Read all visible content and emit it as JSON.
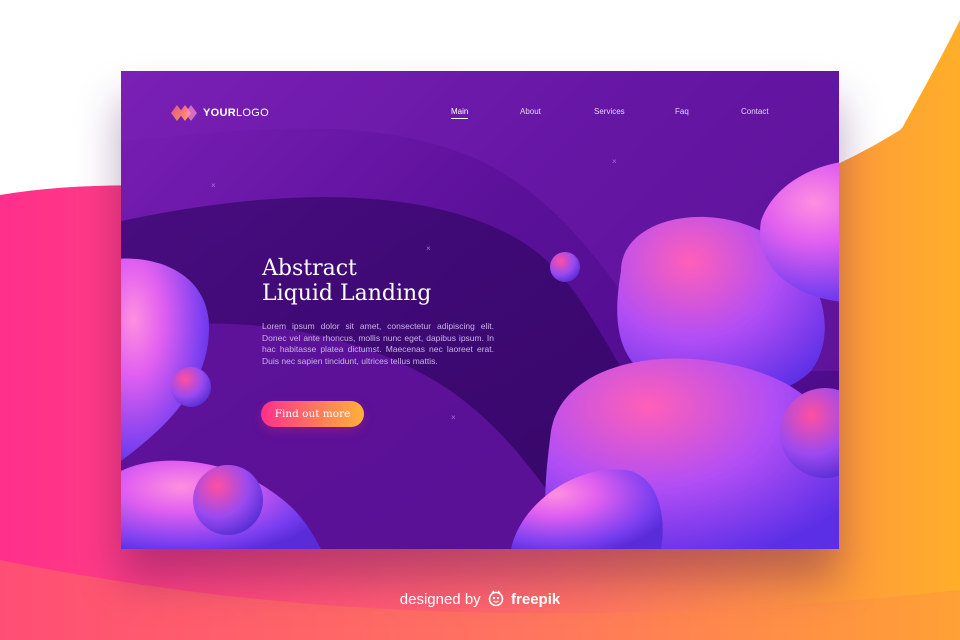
{
  "logo": {
    "bold": "YOUR",
    "light": "LOGO",
    "icon": "diamond-logo-icon"
  },
  "nav": {
    "items": [
      {
        "label": "Main",
        "active": true
      },
      {
        "label": "About",
        "active": false
      },
      {
        "label": "Services",
        "active": false
      },
      {
        "label": "Faq",
        "active": false
      },
      {
        "label": "Contact",
        "active": false
      }
    ]
  },
  "hero": {
    "title_line1": "Abstract",
    "title_line2": "Liquid Landing",
    "body": "Lorem ipsum dolor sit amet, consectetur adipiscing elit. Donec vel ante rhoncus, mollis nunc eget, dapibus ipsum. In hac habitasse platea dictumst. Maecenas nec laoreet erat. Duis nec sapien tincidunt, ultrices tellus mattis.",
    "cta_label": "Find out more"
  },
  "credit": {
    "prefix": "designed by",
    "brand": "freepik",
    "icon": "freepik-mascot-icon"
  },
  "colors": {
    "card_purple": "#5a1099",
    "pink": "#ff2f8c",
    "orange": "#ffb13a",
    "bubble_violet": "#6b3df0"
  }
}
